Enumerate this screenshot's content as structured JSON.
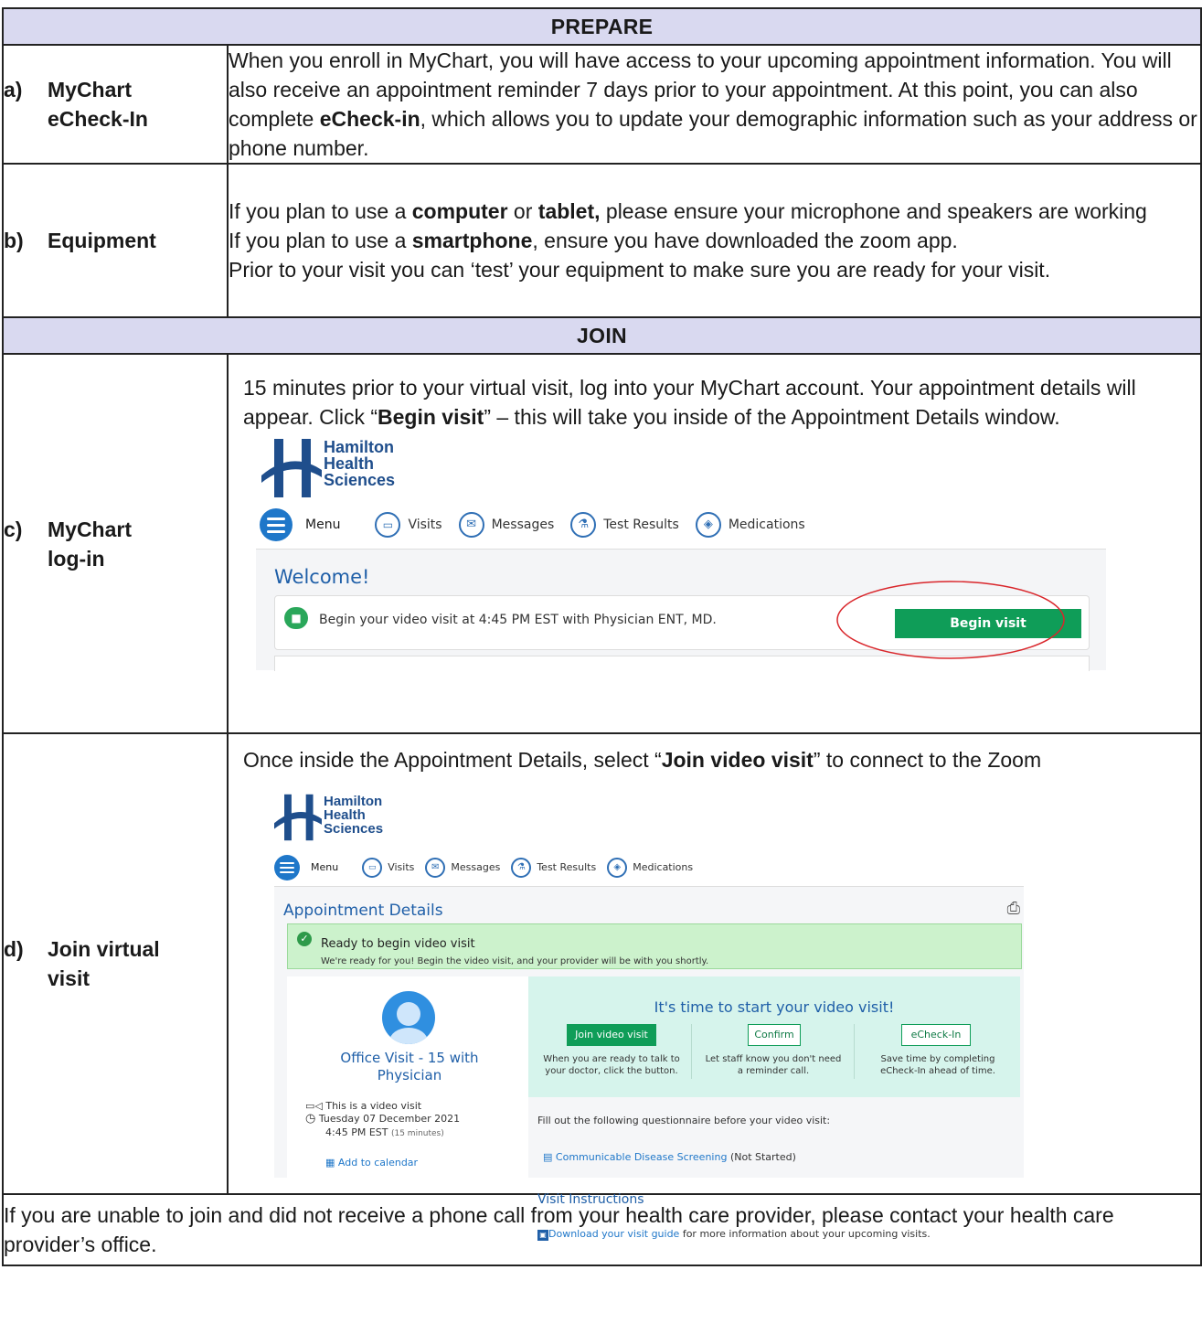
{
  "sections": {
    "prepare": "PREPARE",
    "join": "JOIN"
  },
  "rows": {
    "a": {
      "letter": "a)",
      "label_line1": "MyChart",
      "label_line2": "eCheck-In",
      "t1": "When you enroll in MyChart, you will have access to your upcoming appointment information. You will also receive an appointment reminder 7 days prior to your appointment. At this point, you can also complete ",
      "t1_bold": "eCheck-in",
      "t2": ", which allows you to update your demographic information such as your address or phone number."
    },
    "b": {
      "letter": "b)",
      "label": "Equipment",
      "l1a": "If you plan to use a ",
      "l1b": "computer",
      "l1c": " or ",
      "l1d": "tablet,",
      "l1e": " please ensure your microphone and speakers are working",
      "l2a": "If you plan to use a ",
      "l2b": "smartphone",
      "l2c": ", ensure you have downloaded the zoom app.",
      "l3": "Prior to your visit you can ‘test’ your equipment to make sure you are ready for your visit."
    },
    "c": {
      "letter": "c)",
      "label_line1": "MyChart",
      "label_line2": "log-in",
      "t1": "15 minutes prior to your virtual visit, log into your MyChart account. Your appointment details will appear. Click “",
      "t1_bold": "Begin visit",
      "t2": "” – this will take you inside of the Appointment Details window."
    },
    "d": {
      "letter": "d)",
      "label_line1": "Join virtual",
      "label_line2": "visit",
      "t1": "Once inside the Appointment Details, select “",
      "t1_bold": "Join video visit",
      "t2": "” to connect to the Zoom"
    }
  },
  "footer": "If you are unable to join and did not receive a phone call from your health care provider, please contact your health care provider’s office.",
  "mychart": {
    "logo": [
      "Hamilton",
      "Health",
      "Sciences"
    ],
    "nav": {
      "menu": "Menu",
      "visits": "Visits",
      "messages": "Messages",
      "test_results": "Test Results",
      "medications": "Medications"
    },
    "welcome": "Welcome!",
    "video_msg": "Begin your video visit at 4:45 PM EST with Physician ENT, MD.",
    "begin_visit": "Begin visit"
  },
  "appt": {
    "title": "Appointment Details",
    "ready_title": "Ready to begin video visit",
    "ready_sub": "We're ready for you! Begin the video visit, and your provider will be with you shortly.",
    "visit_name": "Office Visit - 15 with Physician",
    "video_visit": "This is a video visit",
    "date": "Tuesday 07 December 2021",
    "time": "4:45 PM EST",
    "duration": "(15 minutes)",
    "add_cal": "Add to calendar",
    "start_title": "It's time to start your video visit!",
    "join_btn": "Join video visit",
    "join_desc": "When you are ready to talk to your doctor, click the button.",
    "confirm_btn": "Confirm",
    "confirm_desc": "Let staff know you don't need a reminder call.",
    "echeck_btn": "eCheck-In",
    "echeck_desc": "Save time by completing eCheck-In ahead of time.",
    "questionnaire": "Fill out the following questionnaire before your video visit:",
    "screening": "Communicable Disease Screening",
    "screening_status": "(Not Started)",
    "instructions": "Visit Instructions",
    "guide_link": "Download your visit guide",
    "guide_rest": " for more information about your upcoming visits."
  }
}
